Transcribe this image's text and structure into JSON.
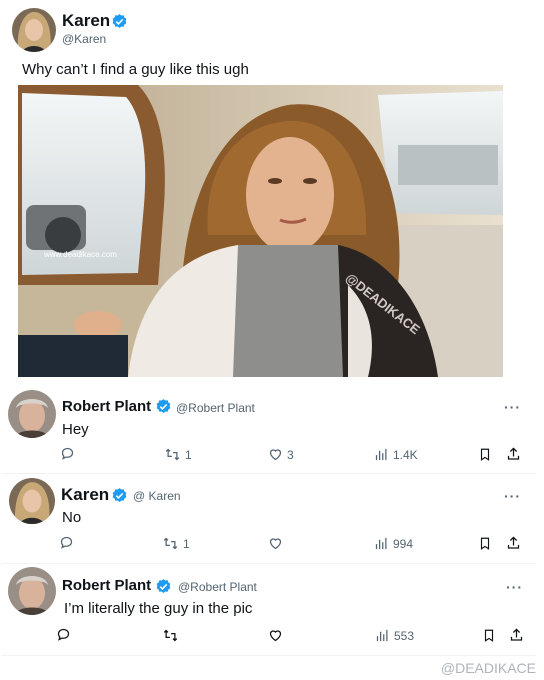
{
  "main_tweet": {
    "author_name": "Karen",
    "author_handle": "@Karen",
    "text": "Why can’t I find a guy like this ugh",
    "photo": {
      "watermark_small": "www.deadikace.com",
      "watermark_diagonal": "@DEADIKACE"
    }
  },
  "replies": [
    {
      "author_name": "Robert Plant",
      "author_handle": "@Robert Plant",
      "text": "Hey",
      "reposts": "1",
      "likes": "3",
      "views": "1.4K"
    },
    {
      "author_name": "Karen",
      "author_handle": "@ Karen",
      "text": "No",
      "reposts": "1",
      "likes": "",
      "views": "994"
    },
    {
      "author_name": "Robert Plant",
      "author_handle": "@Robert Plant",
      "text": "I’m literally the guy in the pic",
      "reposts": "",
      "likes": "",
      "views": "553"
    }
  ],
  "footer_watermark": "@DEADIKACE",
  "colors": {
    "verified": "#1d9bf0",
    "muted": "#536471",
    "text": "#0f1419"
  },
  "icons": [
    "verified-badge-icon",
    "more-icon",
    "reply-icon",
    "repost-icon",
    "like-icon",
    "views-icon",
    "bookmark-icon",
    "share-icon"
  ]
}
